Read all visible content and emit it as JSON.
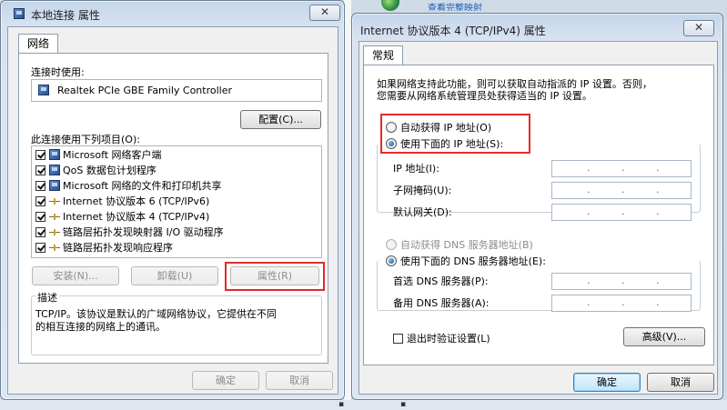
{
  "background": {
    "top_link": "查看完整映射"
  },
  "left_dialog": {
    "title": "本地连接 属性",
    "close_symbol": "✕",
    "tab_label": "网络",
    "connect_using_label": "连接时使用:",
    "adapter_name": "Realtek PCIe GBE Family Controller",
    "configure_button": "配置(C)...",
    "items_label": "此连接使用下列项目(O):",
    "items": [
      {
        "label": "Microsoft 网络客户端",
        "checked": true,
        "icon": "network-client-icon"
      },
      {
        "label": "QoS 数据包计划程序",
        "checked": true,
        "icon": "qos-icon"
      },
      {
        "label": "Microsoft 网络的文件和打印机共享",
        "checked": true,
        "icon": "file-share-icon"
      },
      {
        "label": "Internet 协议版本 6 (TCP/IPv6)",
        "checked": true,
        "icon": "protocol-icon"
      },
      {
        "label": "Internet 协议版本 4 (TCP/IPv4)",
        "checked": true,
        "icon": "protocol-icon"
      },
      {
        "label": "链路层拓扑发现映射器 I/O 驱动程序",
        "checked": true,
        "icon": "protocol-icon"
      },
      {
        "label": "链路层拓扑发现响应程序",
        "checked": true,
        "icon": "protocol-icon"
      }
    ],
    "install_button": "安装(N)...",
    "uninstall_button": "卸载(U)",
    "properties_button": "属性(R)",
    "description_label": "描述",
    "description_text_line1": "TCP/IP。该协议是默认的广域网络协议，它提供在不同",
    "description_text_line2": "的相互连接的网络上的通讯。",
    "ok_button": "确定",
    "cancel_button": "取消"
  },
  "right_dialog": {
    "title": "Internet 协议版本 4 (TCP/IPv4) 属性",
    "close_symbol": "✕",
    "tab_label": "常规",
    "info_line1": "如果网络支持此功能，则可以获取自动指派的 IP 设置。否则，",
    "info_line2": "您需要从网络系统管理员处获得适当的 IP 设置。",
    "auto_ip_label": "自动获得 IP 地址(O)",
    "manual_ip_label": "使用下面的 IP 地址(S):",
    "ip_address_label": "IP 地址(I):",
    "subnet_label": "子网掩码(U):",
    "gateway_label": "默认网关(D):",
    "auto_dns_label": "自动获得 DNS 服务器地址(B)",
    "manual_dns_label": "使用下面的 DNS 服务器地址(E):",
    "preferred_dns_label": "首选 DNS 服务器(P):",
    "alternate_dns_label": "备用 DNS 服务器(A):",
    "validate_label": "退出时验证设置(L)",
    "validate_checked": false,
    "advanced_button": "高级(V)...",
    "ok_button": "确定",
    "cancel_button": "取消",
    "ip_dot": "."
  }
}
